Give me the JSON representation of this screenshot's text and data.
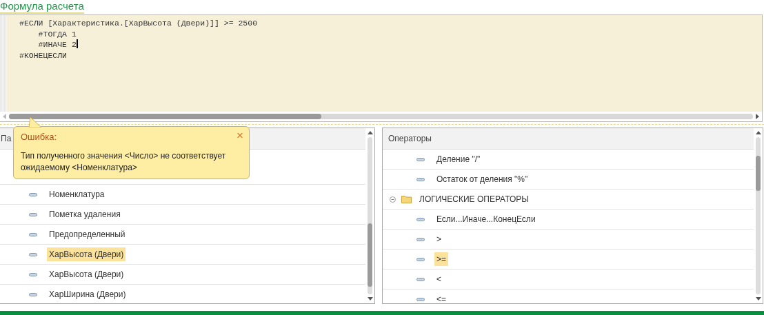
{
  "formula": {
    "title": "Формула расчета",
    "code_lines": [
      "#ЕСЛИ [Характеристика.[ХарВысота (Двери)]] >= 2500",
      "    #ТОГДА 1",
      "    #ИНАЧЕ 2",
      "#КОНЕЦЕСЛИ"
    ]
  },
  "error_tooltip": {
    "title": "Ошибка:",
    "close": "×",
    "message": "Тип полученного значения <Число> не соответствует ожидаемому <Номенклатура>"
  },
  "fields_panel": {
    "header": "Па",
    "items": [
      {
        "label": "Номенклатура",
        "selected": false
      },
      {
        "label": "Пометка удаления",
        "selected": false
      },
      {
        "label": "Предопределенный",
        "selected": false
      },
      {
        "label": "ХарВысота (Двери)",
        "selected": true
      },
      {
        "label": "ХарВысота (Двери)",
        "selected": false
      },
      {
        "label": "ХарШирина (Двери)",
        "selected": false
      }
    ]
  },
  "operators_panel": {
    "header": "Операторы",
    "items": [
      {
        "kind": "item",
        "label": "Деление \"/\"",
        "selected": false
      },
      {
        "kind": "item",
        "label": "Остаток от деления \"%\"",
        "selected": false
      },
      {
        "kind": "group",
        "label": "ЛОГИЧЕСКИЕ ОПЕРАТОРЫ",
        "expanded": true,
        "selected": false,
        "children": [
          {
            "kind": "item",
            "label": "Если...Иначе...КонецЕсли",
            "selected": false
          },
          {
            "kind": "item",
            "label": ">",
            "selected": false
          },
          {
            "kind": "item",
            "label": ">=",
            "selected": true
          },
          {
            "kind": "item",
            "label": "<",
            "selected": false
          },
          {
            "kind": "item",
            "label": "<=",
            "selected": false
          }
        ]
      }
    ]
  }
}
